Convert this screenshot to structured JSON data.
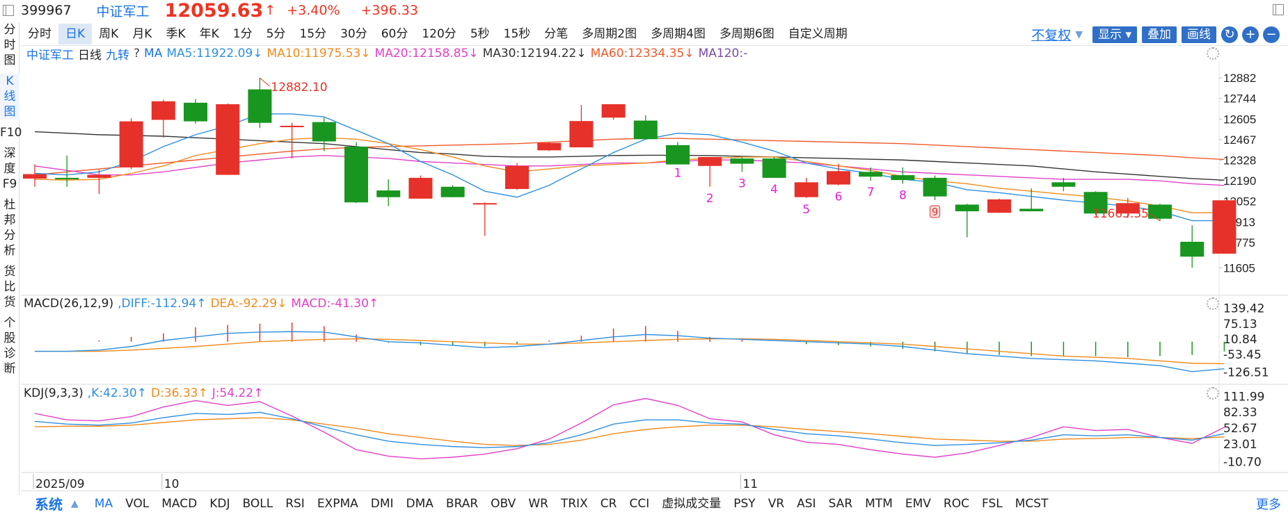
{
  "header": {
    "code": "399967",
    "name": "中证军工",
    "price": "12059.63",
    "price_arrow": "↑",
    "change_pct": "+3.40%",
    "change_abs": "+396.33"
  },
  "left_nav": [
    "分时图",
    "K线图",
    "F10",
    "深度F9",
    "杜邦分析",
    "货比货",
    "个股诊断"
  ],
  "left_nav_active": 1,
  "periods": [
    "分时",
    "日K",
    "周K",
    "月K",
    "季K",
    "年K",
    "1分",
    "5分",
    "15分",
    "30分",
    "60分",
    "120分",
    "5秒",
    "15秒",
    "分笔",
    "多周期2图",
    "多周期4图",
    "多周期6图",
    "自定义周期"
  ],
  "period_active": 1,
  "toolbar": {
    "adjust": "不复权",
    "display": "显示",
    "overlay": "叠加",
    "draw": "画线",
    "refresh_icon": "refresh-icon",
    "zoom_in_icon": "plus-icon",
    "zoom_out_icon": "minus-icon"
  },
  "main_legend": [
    {
      "text": "中证军工",
      "color": "#1a73e8"
    },
    {
      "text": "日线",
      "color": "#222222"
    },
    {
      "text": "九转",
      "color": "#1a73e8"
    },
    {
      "text": "?",
      "color": "#444444"
    },
    {
      "text": "MA",
      "color": "#1a73e8"
    },
    {
      "text": "MA5:11922.09↓",
      "color": "#2e8fe0"
    },
    {
      "text": "MA10:11975.53↓",
      "color": "#f08a1c"
    },
    {
      "text": "MA20:12158.85↓",
      "color": "#e040c8"
    },
    {
      "text": "MA30:12194.22↓",
      "color": "#333333"
    },
    {
      "text": "MA60:12334.35↓",
      "color": "#f05a28"
    },
    {
      "text": "MA120:-",
      "color": "#7a4aa8"
    }
  ],
  "macd_legend": [
    {
      "text": "MACD(26,12,9)",
      "color": "#222222"
    },
    {
      "text": ",DIFF:-112.94↑",
      "color": "#2e8fe0"
    },
    {
      "text": "DEA:-92.29↓",
      "color": "#f08a1c"
    },
    {
      "text": "MACD:-41.30↑",
      "color": "#e040c8"
    }
  ],
  "kdj_legend": [
    {
      "text": "KDJ(9,3,3)",
      "color": "#222222"
    },
    {
      "text": ",K:42.30↑",
      "color": "#2e8fe0"
    },
    {
      "text": "D:36.33↑",
      "color": "#f08a1c"
    },
    {
      "text": "J:54.22↑",
      "color": "#e040c8"
    }
  ],
  "indicators": [
    "MA",
    "VOL",
    "MACD",
    "KDJ",
    "BOLL",
    "RSI",
    "EXPMA",
    "DMI",
    "DMA",
    "BRAR",
    "OBV",
    "WR",
    "TRIX",
    "CR",
    "CCI",
    "虚拟成交量",
    "PSY",
    "VR",
    "ASI",
    "SAR",
    "MTM",
    "EMV",
    "ROC",
    "FSL",
    "MCST"
  ],
  "indicator_active": 0,
  "system_label": "系统",
  "more_label": "更多",
  "colors": {
    "up": "#e6312a",
    "down": "#18961f",
    "ma5": "#2e8fe0",
    "ma10": "#f08a1c",
    "ma20": "#e040c8",
    "ma30": "#333333",
    "ma60": "#f05a28",
    "nine": "#e020d0"
  },
  "chart_data": {
    "type": "candlestick",
    "price_axis": {
      "ticks": [
        12882,
        12744,
        12605,
        12467,
        12328,
        12190,
        12052,
        11913,
        11775,
        11605
      ]
    },
    "macd_axis": {
      "ticks": [
        "139.42",
        "75.13",
        "10.84",
        "-53.45",
        "-126.51"
      ]
    },
    "kdj_axis": {
      "ticks": [
        "111.99",
        "82.33",
        "52.67",
        "23.01",
        "-10.70"
      ]
    },
    "x_labels": [
      {
        "index": 0,
        "text": "2025/09"
      },
      {
        "index": 4,
        "text": "10"
      },
      {
        "index": 22,
        "text": "11"
      }
    ],
    "high_mark": {
      "index": 7,
      "text": "12882.10"
    },
    "low_mark": {
      "index": 35,
      "text": "11605.35"
    },
    "candles": [
      {
        "o": 12205,
        "h": 12300,
        "l": 12150,
        "c": 12235
      },
      {
        "o": 12210,
        "h": 12360,
        "l": 12150,
        "c": 12200
      },
      {
        "o": 12210,
        "h": 12265,
        "l": 12100,
        "c": 12230
      },
      {
        "o": 12280,
        "h": 12610,
        "l": 12270,
        "c": 12590
      },
      {
        "o": 12600,
        "h": 12735,
        "l": 12480,
        "c": 12725
      },
      {
        "o": 12715,
        "h": 12740,
        "l": 12575,
        "c": 12590
      },
      {
        "o": 12230,
        "h": 12710,
        "l": 12230,
        "c": 12705
      },
      {
        "o": 12805,
        "h": 12882,
        "l": 12545,
        "c": 12580
      },
      {
        "o": 12555,
        "h": 12580,
        "l": 12340,
        "c": 12560
      },
      {
        "o": 12585,
        "h": 12615,
        "l": 12390,
        "c": 12455
      },
      {
        "o": 12420,
        "h": 12450,
        "l": 12040,
        "c": 12045
      },
      {
        "o": 12125,
        "h": 12200,
        "l": 12020,
        "c": 12080
      },
      {
        "o": 12070,
        "h": 12225,
        "l": 12070,
        "c": 12210
      },
      {
        "o": 12150,
        "h": 12160,
        "l": 12080,
        "c": 12080
      },
      {
        "o": 12040,
        "h": 12045,
        "l": 11820,
        "c": 12040
      },
      {
        "o": 12135,
        "h": 12310,
        "l": 12130,
        "c": 12290
      },
      {
        "o": 12395,
        "h": 12450,
        "l": 12390,
        "c": 12445
      },
      {
        "o": 12415,
        "h": 12700,
        "l": 12415,
        "c": 12592
      },
      {
        "o": 12615,
        "h": 12695,
        "l": 12600,
        "c": 12705
      },
      {
        "o": 12595,
        "h": 12630,
        "l": 12480,
        "c": 12470
      },
      {
        "o": 12430,
        "h": 12450,
        "l": 12320,
        "c": 12300
      },
      {
        "o": 12290,
        "h": 12350,
        "l": 12150,
        "c": 12350
      },
      {
        "o": 12340,
        "h": 12348,
        "l": 12250,
        "c": 12305
      },
      {
        "o": 12340,
        "h": 12350,
        "l": 12210,
        "c": 12210
      },
      {
        "o": 12080,
        "h": 12210,
        "l": 12075,
        "c": 12180
      },
      {
        "o": 12165,
        "h": 12305,
        "l": 12160,
        "c": 12255
      },
      {
        "o": 12250,
        "h": 12280,
        "l": 12190,
        "c": 12218
      },
      {
        "o": 12228,
        "h": 12280,
        "l": 12170,
        "c": 12195
      },
      {
        "o": 12210,
        "h": 12225,
        "l": 12060,
        "c": 12085
      },
      {
        "o": 12030,
        "h": 12035,
        "l": 11810,
        "c": 11985
      },
      {
        "o": 11975,
        "h": 12070,
        "l": 11975,
        "c": 12065
      },
      {
        "o": 12002,
        "h": 12140,
        "l": 11985,
        "c": 11985
      },
      {
        "o": 12180,
        "h": 12210,
        "l": 12120,
        "c": 12150
      },
      {
        "o": 12115,
        "h": 12120,
        "l": 11960,
        "c": 11970
      },
      {
        "o": 11970,
        "h": 12075,
        "l": 11940,
        "c": 12040
      },
      {
        "o": 12030,
        "h": 12035,
        "l": 11920,
        "c": 11935
      },
      {
        "o": 11780,
        "h": 11890,
        "l": 11605,
        "c": 11680
      },
      {
        "o": 11700,
        "h": 12059,
        "l": 11700,
        "c": 12059
      }
    ],
    "nine_turn": [
      {
        "index": 20,
        "label": "1"
      },
      {
        "index": 21,
        "label": "2"
      },
      {
        "index": 22,
        "label": "3"
      },
      {
        "index": 23,
        "label": "4"
      },
      {
        "index": 24,
        "label": "5"
      },
      {
        "index": 25,
        "label": "6"
      },
      {
        "index": 26,
        "label": "7"
      },
      {
        "index": 27,
        "label": "8"
      },
      {
        "index": 28,
        "label": "9"
      }
    ],
    "ma5": [
      12240,
      12230,
      12250,
      12320,
      12420,
      12500,
      12560,
      12640,
      12640,
      12620,
      12530,
      12440,
      12320,
      12230,
      12120,
      12080,
      12160,
      12270,
      12380,
      12470,
      12510,
      12500,
      12450,
      12390,
      12310,
      12270,
      12240,
      12200,
      12180,
      12130,
      12110,
      12085,
      12060,
      12040,
      12020,
      11985,
      11922,
      11922
    ],
    "ma10": [
      12200,
      12195,
      12200,
      12240,
      12290,
      12360,
      12400,
      12440,
      12470,
      12480,
      12470,
      12440,
      12400,
      12350,
      12290,
      12250,
      12270,
      12290,
      12300,
      12310,
      12330,
      12340,
      12350,
      12350,
      12320,
      12290,
      12260,
      12220,
      12190,
      12170,
      12140,
      12120,
      12100,
      12080,
      12055,
      12020,
      11975,
      11975
    ],
    "ma20": [
      12290,
      12260,
      12230,
      12230,
      12250,
      12280,
      12310,
      12330,
      12350,
      12360,
      12350,
      12340,
      12320,
      12310,
      12300,
      12290,
      12290,
      12300,
      12310,
      12310,
      12320,
      12330,
      12330,
      12320,
      12310,
      12290,
      12270,
      12250,
      12240,
      12230,
      12220,
      12210,
      12200,
      12200,
      12200,
      12190,
      12170,
      12159
    ],
    "ma30": [
      12520,
      12510,
      12500,
      12495,
      12490,
      12480,
      12470,
      12460,
      12450,
      12440,
      12420,
      12400,
      12380,
      12370,
      12355,
      12350,
      12350,
      12355,
      12360,
      12362,
      12362,
      12360,
      12355,
      12350,
      12345,
      12340,
      12335,
      12330,
      12320,
      12310,
      12300,
      12290,
      12270,
      12250,
      12235,
      12220,
      12205,
      12194
    ],
    "ma60": [
      12230,
      12250,
      12270,
      12290,
      12310,
      12330,
      12350,
      12370,
      12390,
      12405,
      12415,
      12420,
      12425,
      12430,
      12435,
      12440,
      12450,
      12460,
      12470,
      12475,
      12475,
      12470,
      12465,
      12460,
      12455,
      12450,
      12445,
      12440,
      12430,
      12420,
      12410,
      12400,
      12390,
      12380,
      12370,
      12360,
      12345,
      12334
    ],
    "macd_bars": [
      0,
      0,
      5,
      20,
      35,
      60,
      70,
      75,
      80,
      65,
      30,
      -5,
      -15,
      -15,
      -20,
      -10,
      5,
      25,
      55,
      65,
      45,
      20,
      10,
      0,
      -10,
      -15,
      -20,
      -30,
      -40,
      -50,
      -55,
      -60,
      -60,
      -60,
      -65,
      -60,
      -55,
      -41
    ],
    "diff": [
      -40,
      -40,
      -35,
      -20,
      5,
      20,
      35,
      40,
      42,
      40,
      20,
      0,
      -5,
      -15,
      -25,
      -20,
      -10,
      5,
      20,
      30,
      25,
      15,
      10,
      5,
      0,
      -5,
      -10,
      -20,
      -35,
      -50,
      -60,
      -70,
      -75,
      -80,
      -90,
      -100,
      -125,
      -113
    ],
    "dea": [
      -40,
      -40,
      -40,
      -35,
      -28,
      -20,
      -10,
      0,
      5,
      10,
      12,
      10,
      5,
      0,
      -5,
      -10,
      -10,
      -5,
      0,
      5,
      10,
      12,
      12,
      10,
      5,
      0,
      -5,
      -10,
      -20,
      -30,
      -40,
      -50,
      -60,
      -65,
      -70,
      -80,
      -90,
      -92
    ],
    "k": [
      65,
      60,
      58,
      62,
      72,
      80,
      78,
      82,
      70,
      55,
      40,
      28,
      22,
      18,
      16,
      18,
      25,
      40,
      60,
      68,
      68,
      62,
      60,
      50,
      42,
      38,
      32,
      25,
      20,
      22,
      25,
      30,
      40,
      38,
      40,
      35,
      30,
      42
    ],
    "d": [
      55,
      56,
      56,
      58,
      63,
      68,
      70,
      72,
      68,
      60,
      52,
      42,
      35,
      28,
      22,
      20,
      22,
      30,
      42,
      50,
      55,
      58,
      58,
      55,
      50,
      46,
      42,
      37,
      32,
      30,
      28,
      28,
      32,
      33,
      35,
      35,
      33,
      36
    ],
    "j": [
      80,
      68,
      66,
      74,
      92,
      104,
      95,
      102,
      75,
      45,
      12,
      0,
      -5,
      -2,
      4,
      14,
      32,
      62,
      96,
      108,
      95,
      70,
      64,
      40,
      26,
      22,
      12,
      4,
      -2,
      6,
      20,
      35,
      55,
      48,
      50,
      35,
      24,
      54
    ]
  }
}
